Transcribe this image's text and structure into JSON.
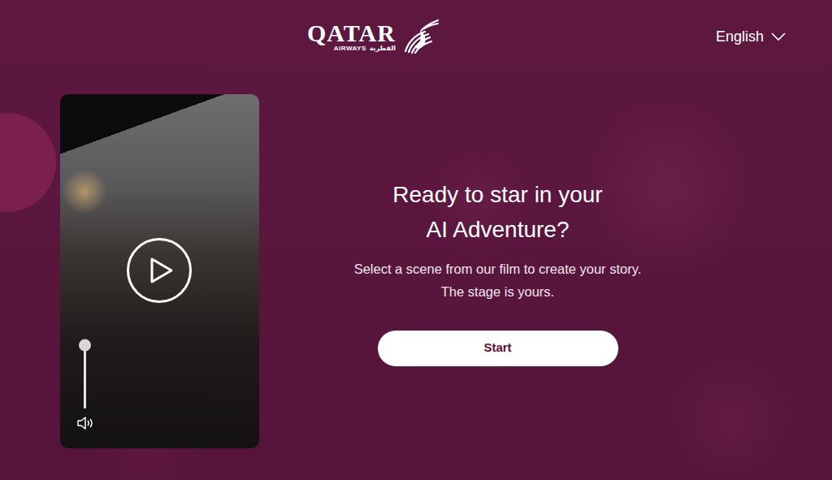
{
  "header": {
    "logo": {
      "name": "QATAR",
      "sub": "AIRWAYS",
      "arabic": "القطرية"
    },
    "language": {
      "label": "English",
      "expanded": false
    }
  },
  "video": {
    "playing": false,
    "volume": {
      "level": 1
    }
  },
  "hero": {
    "heading": [
      "Ready to star in your",
      "AI Adventure?"
    ],
    "subtitle": [
      "Select a scene from our film to create your story.",
      "The stage is yours."
    ],
    "button": "Start"
  }
}
